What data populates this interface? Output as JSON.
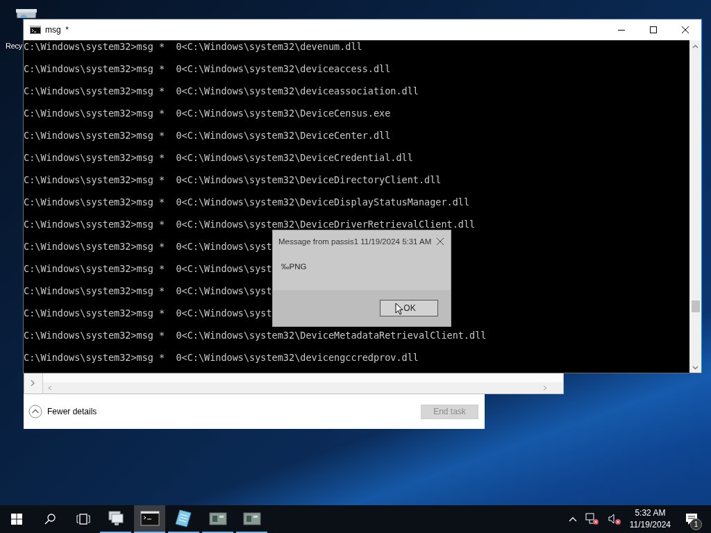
{
  "desktop": {
    "icons": [
      {
        "label": "Recy"
      }
    ]
  },
  "task_manager": {
    "details_toggle": "Fewer details",
    "end_task": {
      "label": "End task",
      "disabled": true
    }
  },
  "console": {
    "title": "msg  *",
    "lines": [
      "C:\\Windows\\system32>msg *  0<C:\\Windows\\system32\\devenum.dll",
      "C:\\Windows\\system32>msg *  0<C:\\Windows\\system32\\deviceaccess.dll",
      "C:\\Windows\\system32>msg *  0<C:\\Windows\\system32\\deviceassociation.dll",
      "C:\\Windows\\system32>msg *  0<C:\\Windows\\system32\\DeviceCensus.exe",
      "C:\\Windows\\system32>msg *  0<C:\\Windows\\system32\\DeviceCenter.dll",
      "C:\\Windows\\system32>msg *  0<C:\\Windows\\system32\\DeviceCredential.dll",
      "C:\\Windows\\system32>msg *  0<C:\\Windows\\system32\\DeviceDirectoryClient.dll",
      "C:\\Windows\\system32>msg *  0<C:\\Windows\\system32\\DeviceDisplayStatusManager.dll",
      "C:\\Windows\\system32>msg *  0<C:\\Windows\\system32\\DeviceDriverRetrievalClient.dll",
      "C:\\Windows\\system32>msg *  0<C:\\Windows\\syst",
      "C:\\Windows\\system32>msg *  0<C:\\Windows\\syst",
      "C:\\Windows\\system32>msg *  0<C:\\Windows\\syst",
      "C:\\Windows\\system32>msg *  0<C:\\Windows\\syst",
      "C:\\Windows\\system32>msg *  0<C:\\Windows\\system32\\DeviceMetadataRetrievalClient.dll",
      "C:\\Windows\\system32>msg *  0<C:\\Windows\\system32\\devicengccredprov.dll"
    ]
  },
  "message_box": {
    "title": "Message from passis1 11/19/2024 5:31 AM",
    "body": "‰PNG",
    "button": "OK"
  },
  "taskbar": {
    "apps": [
      {
        "kind": "server",
        "selected": false
      },
      {
        "kind": "console",
        "selected": true
      },
      {
        "kind": "notepad",
        "selected": false
      },
      {
        "kind": "window",
        "selected": false
      },
      {
        "kind": "window",
        "selected": false
      }
    ],
    "clock": {
      "time": "5:32 AM",
      "date": "11/19/2024"
    },
    "notifications": {
      "count": "1"
    }
  }
}
